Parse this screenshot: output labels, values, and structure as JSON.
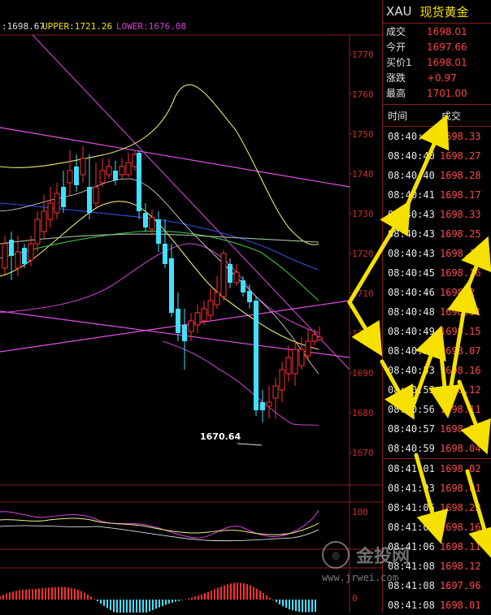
{
  "header": {
    "mid_prefix": ":1698.67",
    "upper": "UPPER:1721.26",
    "lower": "LOWER:1676.08"
  },
  "axis": {
    "price_labels": [
      "1770",
      "1760",
      "1750",
      "1740",
      "1730",
      "1720",
      "1710",
      "1700",
      "1690",
      "1680",
      "1670"
    ],
    "osc_label": "100",
    "macd_label": "0"
  },
  "annotation_low": "1670.64",
  "panel": {
    "code": "XAU",
    "name": "现货黄金",
    "quotes": [
      {
        "label": "成交",
        "value": "1698.01"
      },
      {
        "label": "今开",
        "value": "1697.66"
      },
      {
        "label": "买价1",
        "value": "1698.01"
      },
      {
        "label": "涨跌",
        "value": "+0.97"
      },
      {
        "label": "最高",
        "value": "1701.00"
      }
    ],
    "tick_header": {
      "time": "时间",
      "price": "成交"
    },
    "ticks": [
      {
        "time": "08:40:40",
        "price": "1698.33"
      },
      {
        "time": "08:40:40",
        "price": "1698.27"
      },
      {
        "time": "08:40:40",
        "price": "1698.28"
      },
      {
        "time": "08:40:41",
        "price": "1698.17"
      },
      {
        "time": "08:40:43",
        "price": "1698.33"
      },
      {
        "time": "08:40:43",
        "price": "1698.25"
      },
      {
        "time": "08:40:43",
        "price": "1698.15"
      },
      {
        "time": "08:40:45",
        "price": "1698.16"
      },
      {
        "time": "08:40:46",
        "price": "1698.2"
      },
      {
        "time": "08:40:48",
        "price": "1698.31"
      },
      {
        "time": "08:40:49",
        "price": "1698.15"
      },
      {
        "time": "08:40:51",
        "price": "1698.07"
      },
      {
        "time": "08:40:53",
        "price": "1698.16"
      },
      {
        "time": "08:40:53",
        "price": "1698.12"
      },
      {
        "time": "08:40:56",
        "price": "1698.11"
      },
      {
        "time": "08:40:57",
        "price": "1698.21"
      },
      {
        "time": "08:40:59",
        "price": "1698.04"
      },
      {
        "time": "08:41:01",
        "price": "1698.02"
      },
      {
        "time": "08:41:03",
        "price": "1698.01"
      },
      {
        "time": "08:41:05",
        "price": "1698.23"
      },
      {
        "time": "08:41:05",
        "price": "1698.16"
      },
      {
        "time": "08:41:06",
        "price": "1698.11"
      },
      {
        "time": "08:41:08",
        "price": "1698.12"
      },
      {
        "time": "08:41:08",
        "price": "1697.96"
      },
      {
        "time": "08:41:08",
        "price": "1698.01"
      }
    ]
  },
  "watermark": {
    "brand": "金投网",
    "url": "www.jrwei.com"
  },
  "colors": {
    "up": "#ff3030",
    "down": "#40e0ff",
    "grid": "#8a1e1e",
    "annotation": "#f5e000",
    "upper_band": "#c040c0",
    "mid_band": "#f0f080"
  }
}
